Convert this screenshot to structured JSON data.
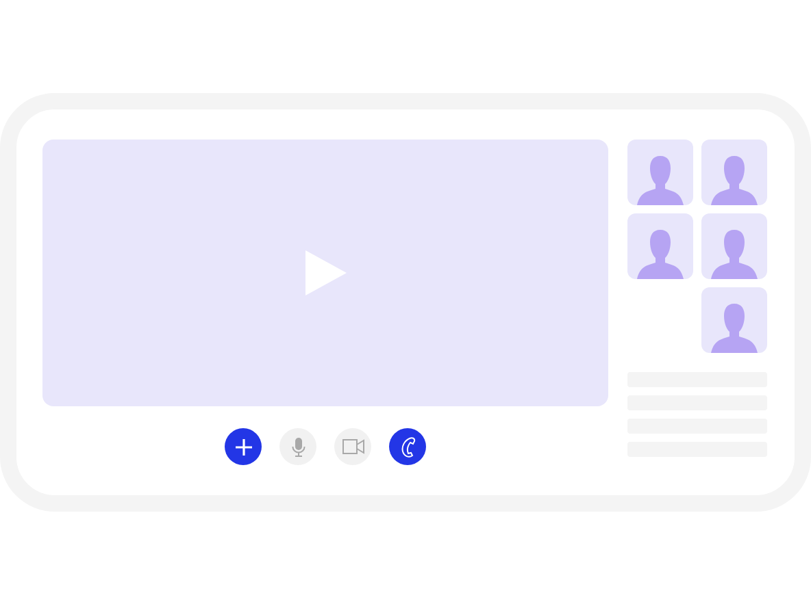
{
  "video": {
    "kind": "paused"
  },
  "controls": [
    {
      "kind": "add",
      "on": true
    },
    {
      "kind": "mic",
      "on": false
    },
    {
      "kind": "camera",
      "on": false
    },
    {
      "kind": "phone",
      "on": true
    }
  ],
  "participants": [
    {
      "kind": "avatar"
    },
    {
      "kind": "avatar"
    },
    {
      "kind": "avatar"
    },
    {
      "kind": "avatar"
    },
    {
      "kind": "empty"
    },
    {
      "kind": "avatar"
    }
  ],
  "lines": [
    {
      "kind": "placeholder"
    },
    {
      "kind": "placeholder"
    },
    {
      "kind": "placeholder"
    },
    {
      "kind": "placeholder"
    }
  ]
}
